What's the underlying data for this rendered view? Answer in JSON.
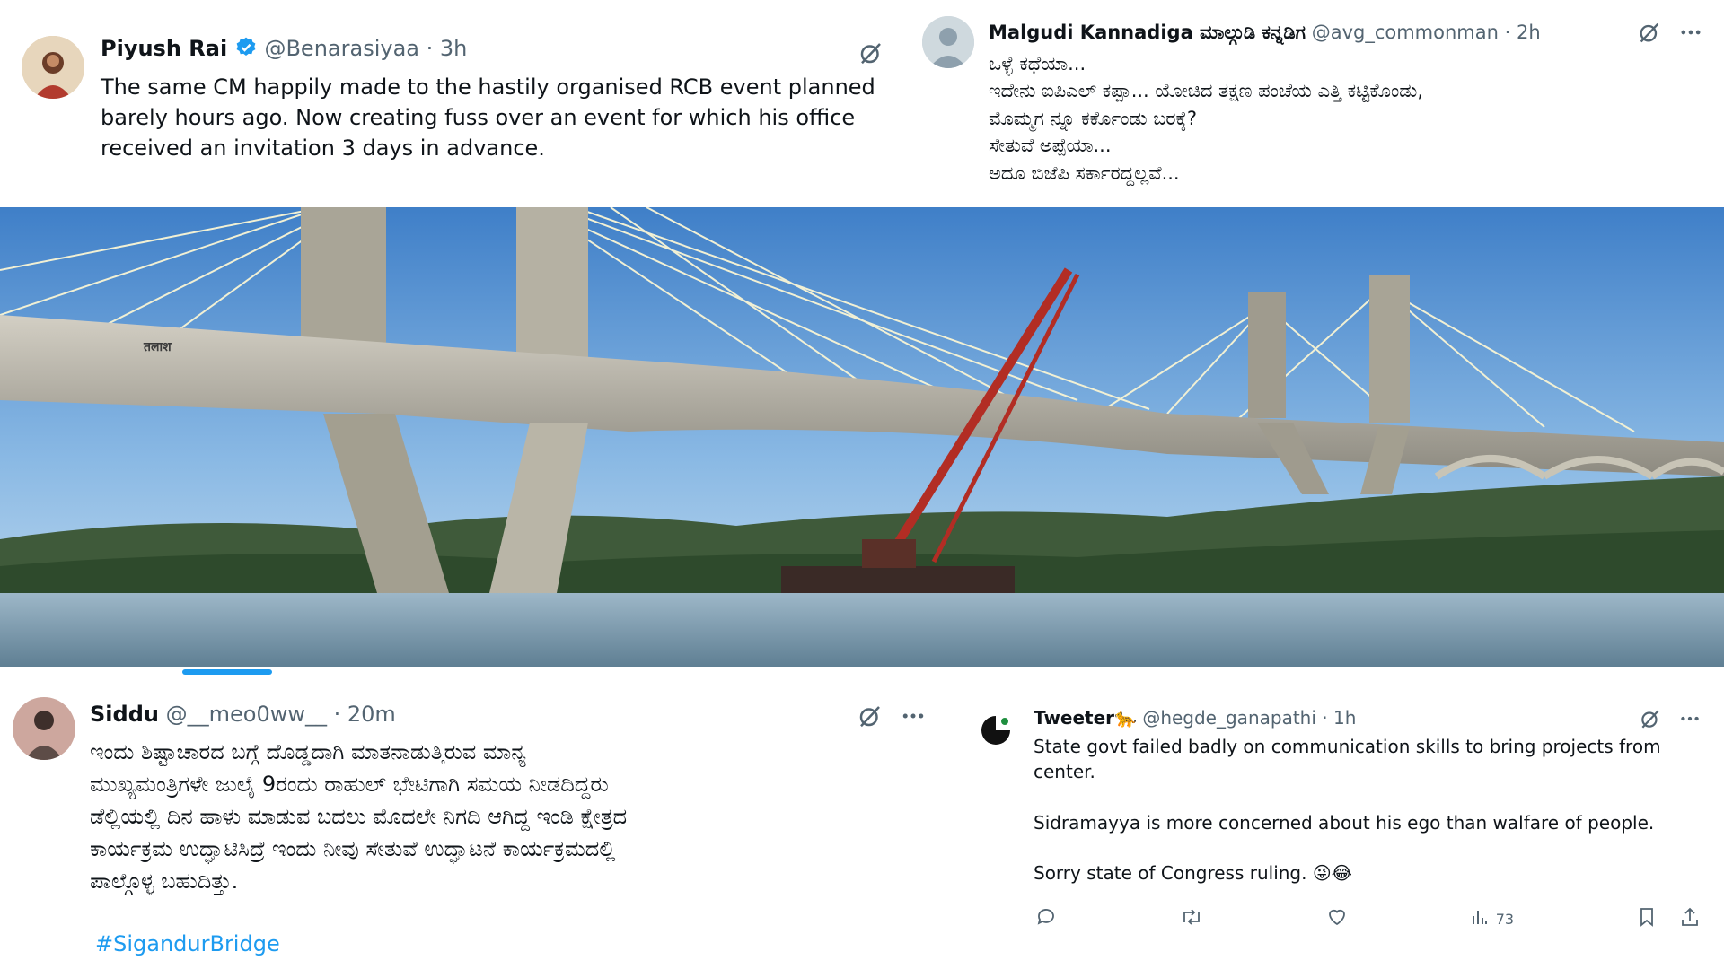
{
  "tweets": {
    "piyush": {
      "name": "Piyush Rai",
      "handle": "@Benarasiyaa",
      "time": "· 3h",
      "text": "The same CM happily made to the hastily organised RCB event planned barely hours ago. Now creating fuss over an event for which his office received an  invitation 3 days in advance.",
      "verified": true
    },
    "malgudi": {
      "name": "Malgudi Kannadiga ಮಾಲ್ಗುಡಿ ಕನ್ನಡಿಗ",
      "handle": "@avg_commonman",
      "time": "· 2h",
      "lines": [
        "ಒಳ್ಳೆ ಕಥೆಯಾ...",
        "ಇದೇನು ಐಪಿಎಲ್ ಕಪ್ಪಾ... ಯೋಚಿದ ತಕ್ಷಣ ಪಂಚೆಯ ಎತ್ತಿ ಕಟ್ಟಿಕೊಂಡು,",
        "ಮೊಮ್ಮಗ ನ್ನೂ ಕರ್ಕೊಂಡು ಬರಕ್ಕೆ?",
        "ಸೇತುವೆ ಅಪ್ಪೆಯಾ...",
        "ಅದೂ ಬಿಜೆಪಿ ಸರ್ಕಾರದ್ದಲ್ಲವೆ..."
      ]
    },
    "siddu": {
      "name": "Siddu",
      "handle": "@__meo0ww__",
      "time": "· 20m",
      "lines": [
        "ಇಂದು ಶಿಷ್ಟಾಚಾರದ ಬಗ್ಗೆ ದೊಡ್ಡದಾಗಿ ಮಾತನಾಡುತ್ತಿರುವ ಮಾನ್ಯ",
        "ಮುಖ್ಯಮಂತ್ರಿಗಳೇ ಜುಲೈ 9ರಂದು  ರಾಹುಲ್ ಭೇಟಿಗಾಗಿ ಸಮಯ ನೀಡದಿದ್ದರು",
        "ಡೆಲ್ಲಿಯಲ್ಲಿ ದಿನ ಹಾಳು ಮಾಡುವ ಬದಲು ಮೊದಲೇ ನಿಗದಿ ಆಗಿದ್ದ ಇಂಡಿ ಕ್ಷೇತ್ರದ",
        "ಕಾರ್ಯಕ್ರಮ ಉದ್ಘಾಟಿಸಿದ್ರೆ ಇಂದು ನೀವು ಸೇತುವೆ ಉದ್ಘಾಟನೆ ಕಾರ್ಯಕ್ರಮದಲ್ಲಿ",
        "ಪಾಲ್ಗೊಳ್ಳ ಬಹುದಿತ್ತು."
      ],
      "hashtag": "#SigandurBridge"
    },
    "tweeter": {
      "name": "Tweeter🐆",
      "handle": "@hegde_ganapathi",
      "time": "· 1h",
      "paragraphs": [
        "State govt failed badly on communication skills to bring projects from center.",
        "Sidramayya is more concerned about his ego than walfare of people.",
        "Sorry state of Congress ruling. 😜😂"
      ],
      "views": "73"
    }
  },
  "photo": {
    "crane_sign": "तलाश"
  },
  "colors": {
    "accent": "#1d9bf0",
    "text": "#0f1419",
    "muted": "#536471"
  },
  "icons": [
    "verified-badge-icon",
    "grok-icon",
    "more-icon",
    "reply-icon",
    "retweet-icon",
    "like-icon",
    "views-icon",
    "bookmark-icon",
    "share-icon"
  ]
}
